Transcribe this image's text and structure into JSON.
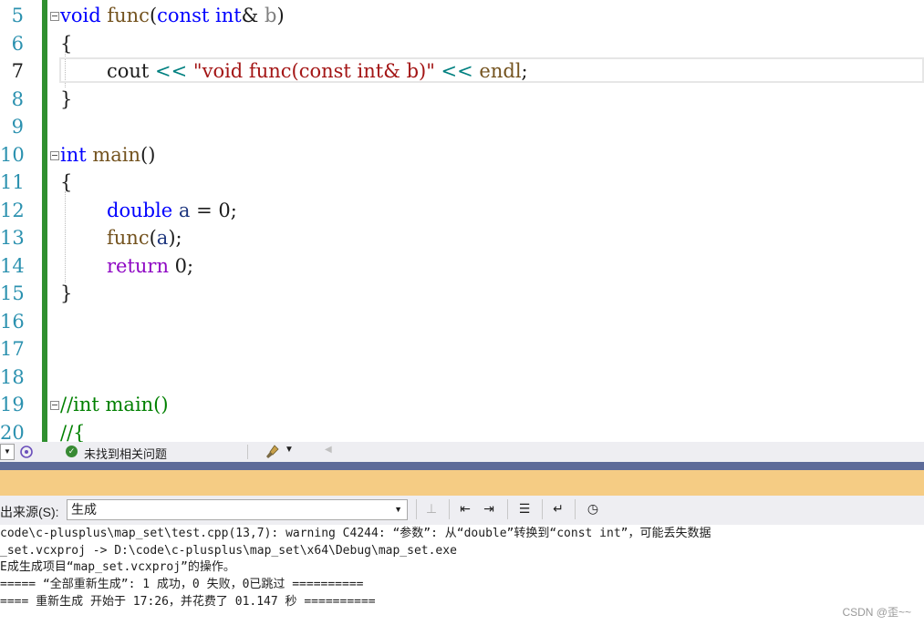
{
  "editor": {
    "line_numbers": [
      "5",
      "6",
      "7",
      "8",
      "9",
      "10",
      "11",
      "12",
      "13",
      "14",
      "15",
      "16",
      "17",
      "18",
      "19",
      "20"
    ],
    "current_line": "7",
    "lines": {
      "l5": {
        "kw": "void",
        "fn": " func",
        "p1": "(",
        "kw2": "const",
        "kw3": " int",
        "amp": "&",
        "var": " b",
        "p2": ")"
      },
      "l6": {
        "text": "{"
      },
      "l7": {
        "a": "cout",
        "op1": " << ",
        "str": "\"void func(const int& b)\"",
        "op2": " << ",
        "b": "endl",
        "semi": ";"
      },
      "l8": {
        "text": "}"
      },
      "l10": {
        "kw": "int",
        "fn": " main",
        "p": "()"
      },
      "l11": {
        "text": "{"
      },
      "l12": {
        "kw": "double",
        "var": " a",
        "rest": " = ",
        "num": "0",
        "semi": ";"
      },
      "l13": {
        "fn": "func",
        "p1": "(",
        "var": "a",
        "p2": ")",
        "semi": ";"
      },
      "l14": {
        "kw": "return",
        "num": " 0",
        "semi": ";"
      },
      "l15": {
        "text": "}"
      },
      "l19": {
        "text": "//int main()"
      },
      "l20": {
        "text": "//{"
      }
    }
  },
  "status": {
    "message": "未找到相关问题"
  },
  "output": {
    "source_label": "出来源(S):",
    "source_value": "生成",
    "lines": [
      "code\\c-plusplus\\map_set\\test.cpp(13,7): warning C4244: “参数”: 从“double”转换到“const int”，可能丢失数据",
      "_set.vcxproj -> D:\\code\\c-plusplus\\map_set\\x64\\Debug\\map_set.exe",
      "E成生成项目“map_set.vcxproj”的操作。",
      "===== “全部重新生成”: 1 成功，0 失败，0已跳过 ==========",
      "==== 重新生成 开始于 17:26，并花费了 01.147 秒 =========="
    ]
  },
  "watermark": "CSDN @歪~~",
  "colors": {
    "keyword": "#0000ff",
    "function": "#74531f",
    "string": "#a31515",
    "comment": "#008000",
    "return_keyword": "#8f08c4",
    "change_bar": "#2f8f2f",
    "orange_bar": "#f5cc84",
    "blue_bar": "#5d6b99"
  }
}
